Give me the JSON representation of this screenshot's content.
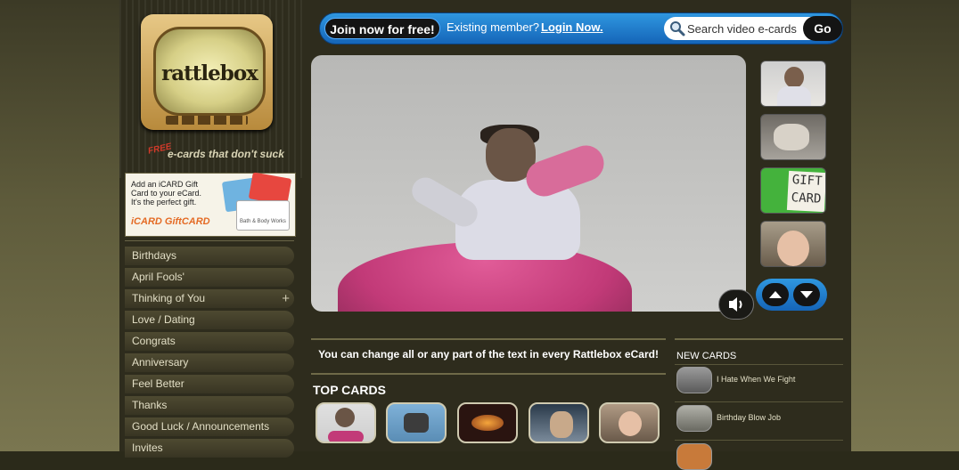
{
  "brand": {
    "logo_text": "rattlebox",
    "tagline_free": "FREE",
    "tagline": "e-cards that don't suck"
  },
  "ad": {
    "text": "Add an iCARD Gift Card to your eCard. It's the perfect gift.",
    "brand": "iCARD GiftCARD",
    "card_caption": "Bath & Body Works"
  },
  "sidebar": {
    "items": [
      {
        "label": "Birthdays",
        "expandable": false
      },
      {
        "label": "April Fools'",
        "expandable": false
      },
      {
        "label": "Thinking of You",
        "expandable": true
      },
      {
        "label": "Love / Dating",
        "expandable": false
      },
      {
        "label": "Congrats",
        "expandable": false
      },
      {
        "label": "Anniversary",
        "expandable": false
      },
      {
        "label": "Feel Better",
        "expandable": false
      },
      {
        "label": "Thanks",
        "expandable": false
      },
      {
        "label": "Good Luck / Announcements",
        "expandable": false
      },
      {
        "label": "Invites",
        "expandable": false
      }
    ],
    "plus_symbol": "+"
  },
  "topbar": {
    "join_label": "Join now for free!",
    "existing_text": "Existing member?",
    "login_label": "Login Now.",
    "search_placeholder": "Search video e-cards",
    "go_label": "Go"
  },
  "video_thumbs": {
    "gift_card_text": "GIFT CARD"
  },
  "main": {
    "info_text": "You can change all or any part of the text in every Rattlebox eCard!",
    "top_cards_title": "TOP CARDS"
  },
  "new_cards": {
    "title": "NEW CARDS",
    "items": [
      {
        "label": "I Hate When We Fight"
      },
      {
        "label": "Birthday Blow Job"
      }
    ]
  },
  "colors": {
    "accent_blue": "#1e7fd4",
    "sidebar_text": "#e3dfc6",
    "tutu_pink": "#c23a78",
    "gift_green": "#44b23c"
  }
}
